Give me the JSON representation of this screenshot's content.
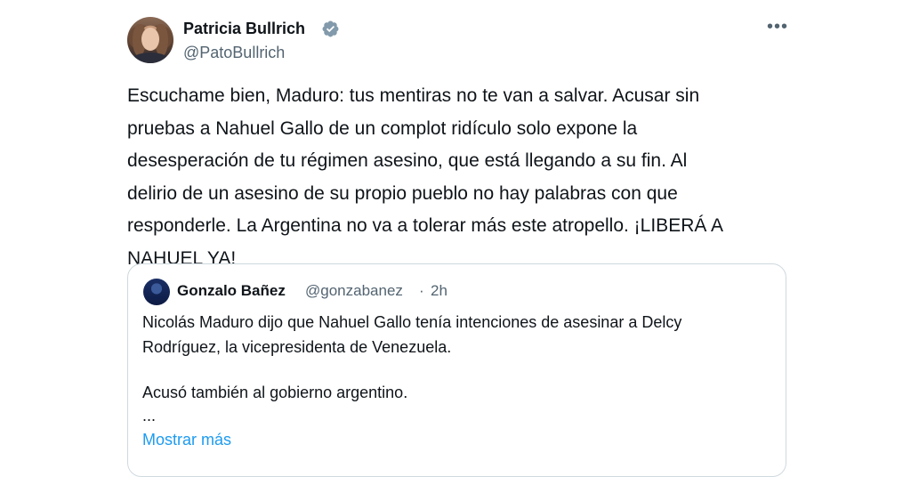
{
  "post": {
    "author_name": "Patricia Bullrich",
    "author_handle": "@PatoBullrich",
    "more_icon": "more-horizontal-icon",
    "verified_icon": "verified-badge-icon",
    "text": "Escuchame bien, Maduro: tus mentiras no te van a salvar. Acusar sin\npruebas a Nahuel Gallo de un complot ridículo solo expone la\ndesesperación de tu régimen asesino, que está llegando a su fin. Al\ndelirio de un asesino de su propio pueblo no hay palabras con que\nresponderle. La Argentina no va a tolerar más este atropello. ¡LIBERÁ A\nNAHUEL YA!"
  },
  "quote": {
    "author_name": "Gonzalo Bañez",
    "author_handle": "@gonzabanez",
    "separator": "·",
    "time": "2h",
    "lines": [
      "Nicolás Maduro dijo que Nahuel Gallo tenía intenciones de asesinar a Delcy",
      "Rodríguez, la vicepresidenta de Venezuela.",
      "Acusó también al gobierno argentino.",
      "..."
    ],
    "show_more": "Mostrar más"
  },
  "colors": {
    "text": "#0f1419",
    "secondary": "#536471",
    "link": "#1d9bf0",
    "verified": "#829aab",
    "border": "#cfd9de"
  }
}
